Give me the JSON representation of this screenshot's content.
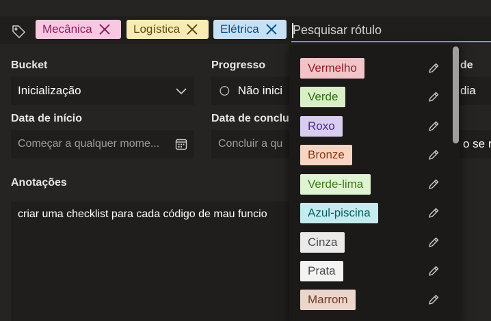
{
  "tag_bar": {
    "selected_labels": [
      {
        "name": "Mecânica",
        "bg": "#f7c8e0",
        "fg": "#8a1e5e"
      },
      {
        "name": "Logística",
        "bg": "#f8ecb4",
        "fg": "#5c4a0c"
      },
      {
        "name": "Elétrica",
        "bg": "#c7e0f4",
        "fg": "#004e8c"
      }
    ],
    "search_placeholder": "Pesquisar rótulo"
  },
  "form": {
    "bucket_label": "Bucket",
    "bucket_value": "Inicialização",
    "progress_label": "Progresso",
    "progress_value": "Não inici",
    "priority_label_fragment": "de",
    "priority_value_fragment": "dia",
    "start_date_label": "Data de início",
    "start_date_placeholder": "Começar a qualquer mome...",
    "due_date_label": "Data de conclu",
    "due_date_placeholder": "Concluir a qu",
    "repeat_fragment": "o se re",
    "notes_label": "Anotações",
    "notes_value": "criar uma checklist para cada código de mau funcio"
  },
  "dropdown": {
    "options": [
      {
        "name": "Vermelho",
        "bg": "#f2c4c7",
        "fg": "#8b1d23"
      },
      {
        "name": "Verde",
        "bg": "#d9f0c7",
        "fg": "#2e6b10"
      },
      {
        "name": "Roxo",
        "bg": "#d9cdf0",
        "fg": "#4a2b8a"
      },
      {
        "name": "Bronze",
        "bg": "#f7d5c3",
        "fg": "#8a3a10"
      },
      {
        "name": "Verde-lima",
        "bg": "#dff4d3",
        "fg": "#3b7a17"
      },
      {
        "name": "Azul-piscina",
        "bg": "#c4ecee",
        "fg": "#0b5f66"
      },
      {
        "name": "Cinza",
        "bg": "#eaeaea",
        "fg": "#4a4a4a"
      },
      {
        "name": "Prata",
        "bg": "#f3f3f3",
        "fg": "#4a4a4a"
      },
      {
        "name": "Marrom",
        "bg": "#ecd6cc",
        "fg": "#6b3a22"
      }
    ],
    "edit_icon": "pencil-icon"
  },
  "colors": {
    "accent_underline": "#8c8cff",
    "background": "#252423"
  }
}
